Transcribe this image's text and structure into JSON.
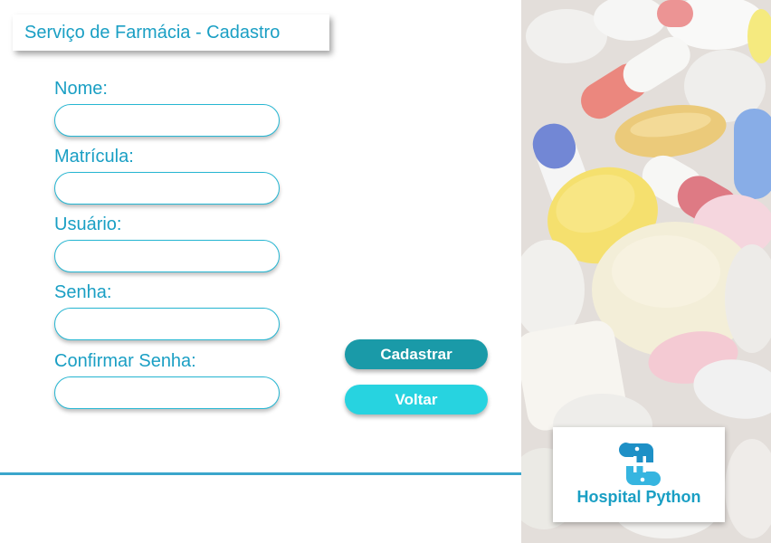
{
  "header": {
    "title": "Serviço de Farmácia - Cadastro"
  },
  "form": {
    "fields": [
      {
        "label": "Nome:",
        "value": ""
      },
      {
        "label": "Matrícula:",
        "value": ""
      },
      {
        "label": "Usuário:",
        "value": ""
      },
      {
        "label": "Senha:",
        "value": ""
      },
      {
        "label": "Confirmar Senha:",
        "value": ""
      }
    ]
  },
  "actions": {
    "register_label": "Cadastrar",
    "back_label": "Voltar"
  },
  "logo": {
    "text": "Hospital Python",
    "icon": "python-h-icon"
  },
  "colors": {
    "accent": "#1a9fc4",
    "button_primary": "#1a9aa8",
    "button_secondary": "#27d3e0",
    "divider": "#3aa6cc"
  },
  "image": {
    "subject": "pills-photo"
  }
}
